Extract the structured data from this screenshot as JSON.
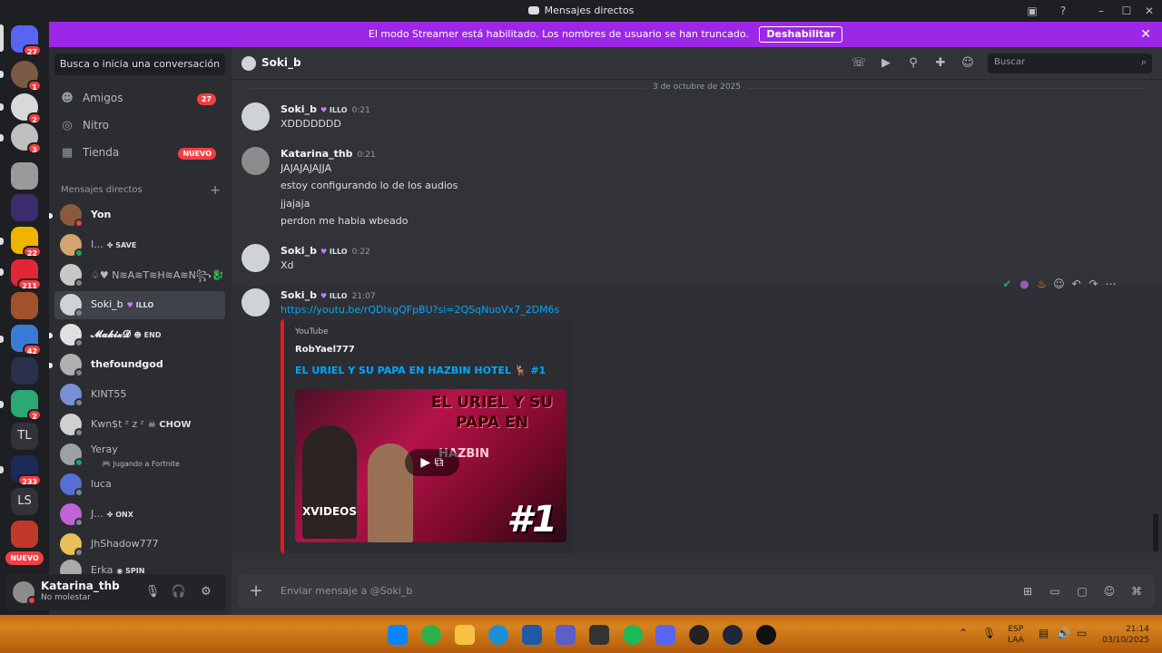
{
  "window": {
    "title": "Mensajes directos"
  },
  "banner": {
    "text": "El modo Streamer está habilitado. Los nombres de usuario se han truncado.",
    "button": "Deshabilitar",
    "close_icon": "close-icon"
  },
  "rail": {
    "home_badge": "27",
    "badges": [
      "1",
      "2",
      "3",
      "22",
      "211",
      "42",
      "2",
      "233"
    ],
    "text_servers": [
      "TL",
      "LS"
    ],
    "nuevo": "NUEVO"
  },
  "sidebar": {
    "search": "Busca o inicia una conversación",
    "nav": [
      {
        "label": "Amigos",
        "badge": "27",
        "icon": "friends-icon"
      },
      {
        "label": "Nitro",
        "badge": "",
        "icon": "nitro-icon"
      },
      {
        "label": "Tienda",
        "badge": "NUEVO",
        "icon": "shop-icon"
      }
    ],
    "section": "Mensajes directos",
    "dms": [
      {
        "name": "Yon",
        "tag": "",
        "sub": ""
      },
      {
        "name": "I...",
        "tag": "SAVE",
        "sub": ""
      },
      {
        "name": "♤♥ N≋A≋T≋H≋A≋N꧂🐉",
        "tag": "",
        "sub": ""
      },
      {
        "name": "Soki_b",
        "tag": "ILLO",
        "sub": ""
      },
      {
        "name": "𝓜𝓪𝓴𝓲𝔁𝓓",
        "tag": "END",
        "sub": ""
      },
      {
        "name": "thefoundgod",
        "tag": "",
        "sub": ""
      },
      {
        "name": "KINT55",
        "tag": "",
        "sub": ""
      },
      {
        "name": "Kwn$t ᶻ z ᶻ",
        "tag": "CHOW",
        "sub": ""
      },
      {
        "name": "Yeray",
        "tag": "",
        "sub": "Jugando a Fortnite"
      },
      {
        "name": "luca",
        "tag": "",
        "sub": ""
      },
      {
        "name": "J...",
        "tag": "ONX",
        "sub": ""
      },
      {
        "name": "JhShadow777",
        "tag": "",
        "sub": ""
      },
      {
        "name": "Erka",
        "tag": "SPIN",
        "sub": ""
      }
    ]
  },
  "user": {
    "name": "Katarina_thb",
    "status": "No molestar"
  },
  "header": {
    "name": "Soki_b",
    "search_placeholder": "Buscar"
  },
  "chat": {
    "date": "3 de octubre de 2025",
    "messages": [
      {
        "author": "Soki_b",
        "role": "ILLO",
        "time": "0:21",
        "lines": [
          "XDDDDDDD"
        ]
      },
      {
        "author": "Katarina_thb",
        "role": "",
        "time": "0:21",
        "lines": [
          "JAJAJAJAJJA",
          "estoy configurando lo de los audios",
          "jjajaja",
          "perdon me habia wbeado"
        ]
      },
      {
        "author": "Soki_b",
        "role": "ILLO",
        "time": "0:22",
        "lines": [
          "Xd"
        ]
      },
      {
        "author": "Soki_b",
        "role": "ILLO",
        "time": "21:07",
        "lines": [
          "https://youtu.be/rQDlxgQFpBU?si=2QSqNuoVx7_2DM6s"
        ]
      }
    ],
    "embed": {
      "provider": "YouTube",
      "author": "RobYael777",
      "title": "EL URIEL Y SU PAPA EN HAZBIN HOTEL 🦌 #1",
      "thumb_text": "EL URIEL Y SU PAPA EN",
      "thumb_logo": "HAZBIN",
      "thumb_number": "#1",
      "thumb_watermark": "XVIDEOS"
    }
  },
  "composer": {
    "placeholder": "Enviar mensaje a @Soki_b"
  },
  "taskbar": {
    "lang": "ESP",
    "layout": "LAA",
    "time": "21:14",
    "date": "03/10/2025"
  },
  "colors": {
    "banner": "#9c27e6",
    "badge": "#f23f43",
    "accent_link": "#00a8fc"
  }
}
